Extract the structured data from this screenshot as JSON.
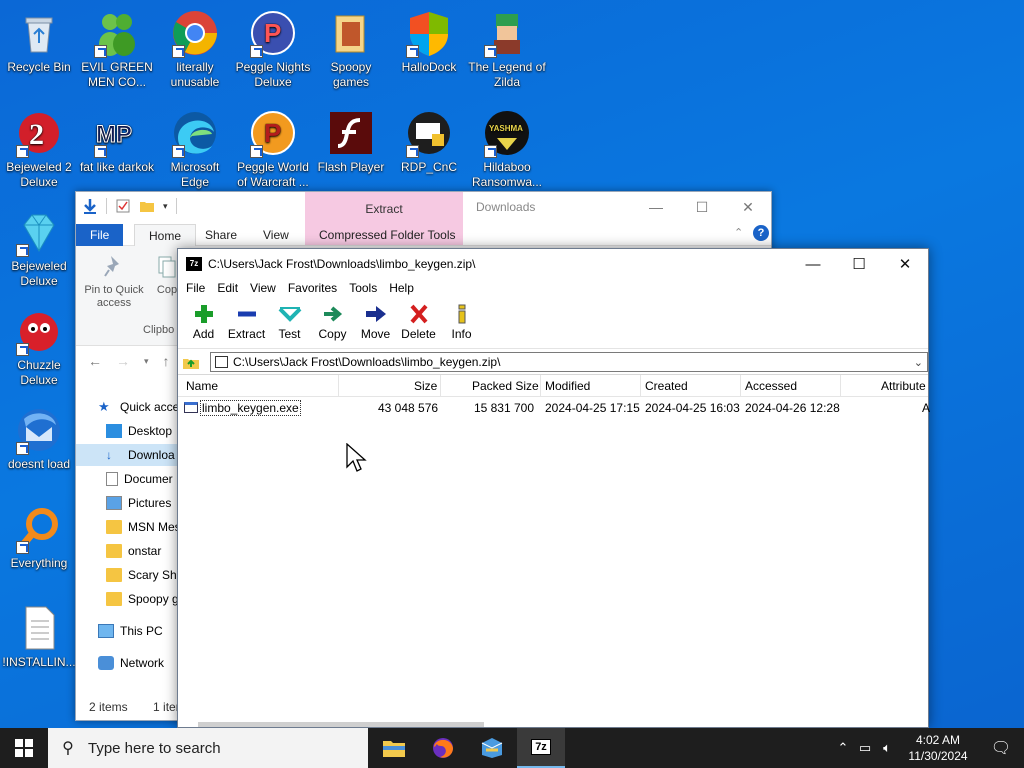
{
  "desktop": {
    "icons": [
      {
        "label": "Recycle Bin"
      },
      {
        "label": "EVIL GREEN MEN CO..."
      },
      {
        "label": "literally unusable"
      },
      {
        "label": "Peggle Nights Deluxe"
      },
      {
        "label": "Spoopy games"
      },
      {
        "label": "HalloDock"
      },
      {
        "label": "The Legend of Zilda"
      },
      {
        "label": "Bejeweled 2 Deluxe"
      },
      {
        "label": "fat like darkok"
      },
      {
        "label": "Microsoft Edge"
      },
      {
        "label": "Peggle World of Warcraft ..."
      },
      {
        "label": "Flash Player"
      },
      {
        "label": "RDP_CnC"
      },
      {
        "label": "Hildaboo Ransomwa..."
      },
      {
        "label": "Bejeweled Deluxe"
      },
      {
        "label": "Chuzzle Deluxe"
      },
      {
        "label": "doesnt load"
      },
      {
        "label": "Everything"
      },
      {
        "label": "!INSTALLIN..."
      }
    ]
  },
  "explorer": {
    "title": "Downloads",
    "context_tab": "Extract",
    "context_group": "Compressed Folder Tools",
    "tabs": {
      "file": "File",
      "home": "Home",
      "share": "Share",
      "view": "View"
    },
    "ribbon": {
      "pin": "Pin to Quick access",
      "copy": "Cop",
      "group": "Clipbo"
    },
    "tree": {
      "quick_access": "Quick acce",
      "desktop": "Desktop",
      "downloads": "Downloa",
      "documents": "Documer",
      "pictures": "Pictures",
      "msn": "MSN Mes",
      "onstar": "onstar",
      "scary": "Scary Shi",
      "spoopy": "Spoopy g",
      "this_pc": "This PC",
      "network": "Network"
    },
    "status_items": "2 items",
    "status_selected": "1 iten"
  },
  "sevenzip": {
    "title": "C:\\Users\\Jack Frost\\Downloads\\limbo_keygen.zip\\",
    "app_icon_text": "7z",
    "menu": [
      "File",
      "Edit",
      "View",
      "Favorites",
      "Tools",
      "Help"
    ],
    "toolbar": {
      "add": "Add",
      "extract": "Extract",
      "test": "Test",
      "copy": "Copy",
      "move": "Move",
      "delete": "Delete",
      "info": "Info"
    },
    "address": "C:\\Users\\Jack Frost\\Downloads\\limbo_keygen.zip\\",
    "columns": {
      "name": "Name",
      "size": "Size",
      "packed": "Packed Size",
      "modified": "Modified",
      "created": "Created",
      "accessed": "Accessed",
      "attributes": "Attribute"
    },
    "rows": [
      {
        "name": "limbo_keygen.exe",
        "size": "43 048 576",
        "packed": "15 831 700",
        "modified": "2024-04-25 17:15",
        "created": "2024-04-25 16:03",
        "accessed": "2024-04-26 12:28",
        "attributes": "A"
      }
    ]
  },
  "taskbar": {
    "search_placeholder": "Type here to search",
    "active_app_label": "7z",
    "time": "4:02 AM",
    "date": "11/30/2024"
  }
}
